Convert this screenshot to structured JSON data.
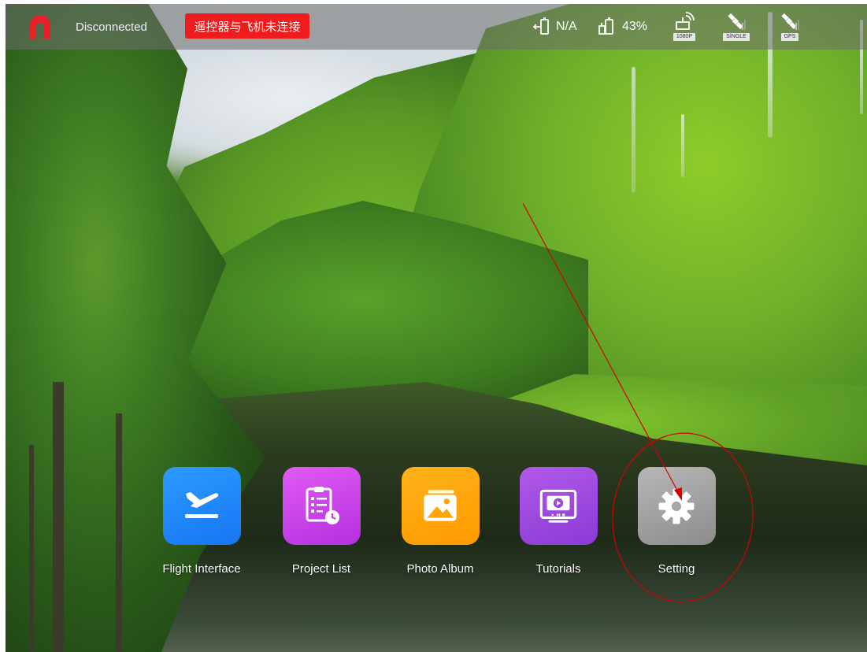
{
  "status_bar": {
    "connection_status": "Disconnected",
    "warning_banner": "遥控器与飞机未连接",
    "aircraft_battery": "N/A",
    "controller_battery": "43%",
    "video_tag": "1080P",
    "signal_tag": "SINGLE",
    "gps_tag": "GPS"
  },
  "apps": [
    {
      "label": "Flight Interface",
      "icon": "plane-icon"
    },
    {
      "label": "Project List",
      "icon": "clipboard-icon"
    },
    {
      "label": "Photo Album",
      "icon": "picture-icon"
    },
    {
      "label": "Tutorials",
      "icon": "video-player-icon"
    },
    {
      "label": "Setting",
      "icon": "gear-icon"
    }
  ],
  "colors": {
    "warning": "#ee1c1c",
    "annotation": "#d40000",
    "flight": "#1e88ff",
    "project": "#c840ea",
    "album": "#ffa500",
    "tutorials": "#9b47de",
    "setting": "#9e9e9e"
  }
}
